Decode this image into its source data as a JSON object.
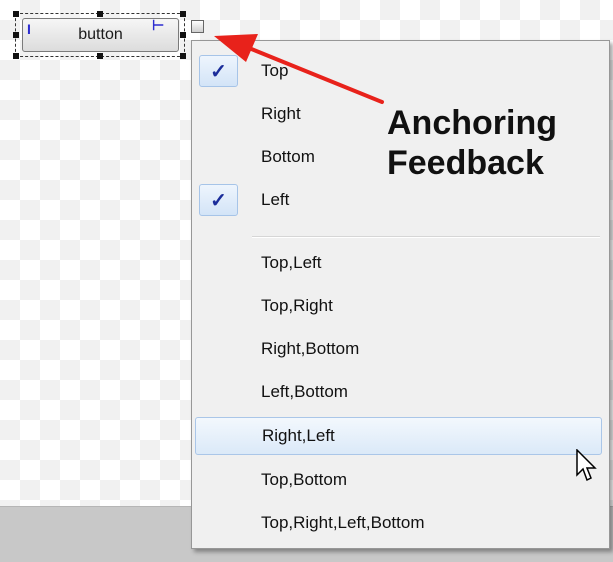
{
  "design_button": {
    "label": "button"
  },
  "menu": {
    "items": [
      {
        "label": "Top",
        "checked": true
      },
      {
        "label": "Right",
        "checked": false
      },
      {
        "label": "Bottom",
        "checked": false
      },
      {
        "label": "Left",
        "checked": true
      },
      {
        "label": "Top,Left",
        "checked": false
      },
      {
        "label": "Top,Right",
        "checked": false
      },
      {
        "label": "Right,Bottom",
        "checked": false
      },
      {
        "label": "Left,Bottom",
        "checked": false
      },
      {
        "label": "Right,Left",
        "checked": false,
        "hovered": true
      },
      {
        "label": "Top,Bottom",
        "checked": false
      },
      {
        "label": "Top,Right,Left,Bottom",
        "checked": false
      }
    ],
    "check_glyph": "✓"
  },
  "annotation": {
    "text_line1": "Anchoring",
    "text_line2": "Feedback",
    "arrow_color": "#e8221b"
  },
  "icons": {
    "check": "checkmark-icon",
    "cursor": "mouse-pointer-icon",
    "arrow": "red-arrow-icon"
  }
}
